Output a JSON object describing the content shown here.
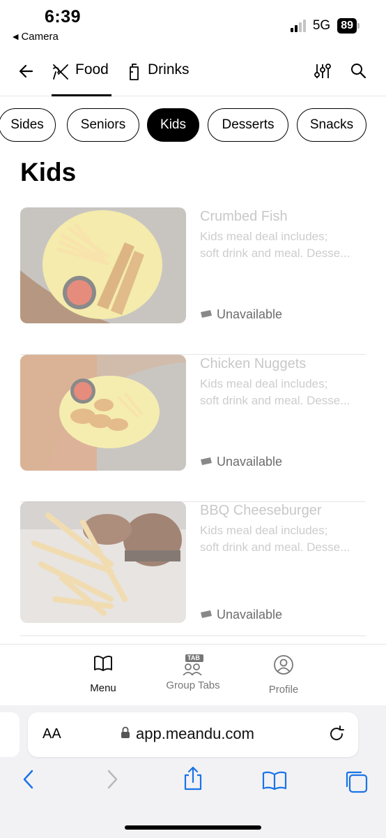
{
  "status": {
    "time": "6:39",
    "back_app": "Camera",
    "network": "5G",
    "battery": "89"
  },
  "header": {
    "tabs": [
      {
        "label": "Food",
        "icon": "utensils-icon",
        "active": true
      },
      {
        "label": "Drinks",
        "icon": "drink-icon",
        "active": false
      }
    ]
  },
  "categories": [
    {
      "label": "Sides",
      "active": false
    },
    {
      "label": "Seniors",
      "active": false
    },
    {
      "label": "Kids",
      "active": true
    },
    {
      "label": "Desserts",
      "active": false
    },
    {
      "label": "Snacks",
      "active": false
    }
  ],
  "section": {
    "title": "Kids"
  },
  "items": [
    {
      "name": "Crumbed Fish",
      "desc_line1": "Kids meal deal includes;",
      "desc_line2": "soft drink and meal. Desse...",
      "status": "Unavailable"
    },
    {
      "name": "Chicken Nuggets",
      "desc_line1": "Kids meal deal includes;",
      "desc_line2": "soft drink and meal. Desse...",
      "status": "Unavailable"
    },
    {
      "name": "BBQ Cheeseburger",
      "desc_line1": "Kids meal deal includes;",
      "desc_line2": "soft drink and meal. Desse...",
      "status": "Unavailable"
    }
  ],
  "bottom_nav": [
    {
      "label": "Menu",
      "icon": "book-open-icon",
      "active": true
    },
    {
      "label": "Group Tabs",
      "icon": "group-tab-icon",
      "badge": "TAB",
      "active": false
    },
    {
      "label": "Profile",
      "icon": "profile-icon",
      "active": false
    }
  ],
  "browser": {
    "text_size_label": "AA",
    "url": "app.meandu.com"
  },
  "colors": {
    "accent": "#000000",
    "muted_text": "#c8c8c8",
    "status_text": "#6c6c6c",
    "browser_blue": "#1a73e8"
  }
}
